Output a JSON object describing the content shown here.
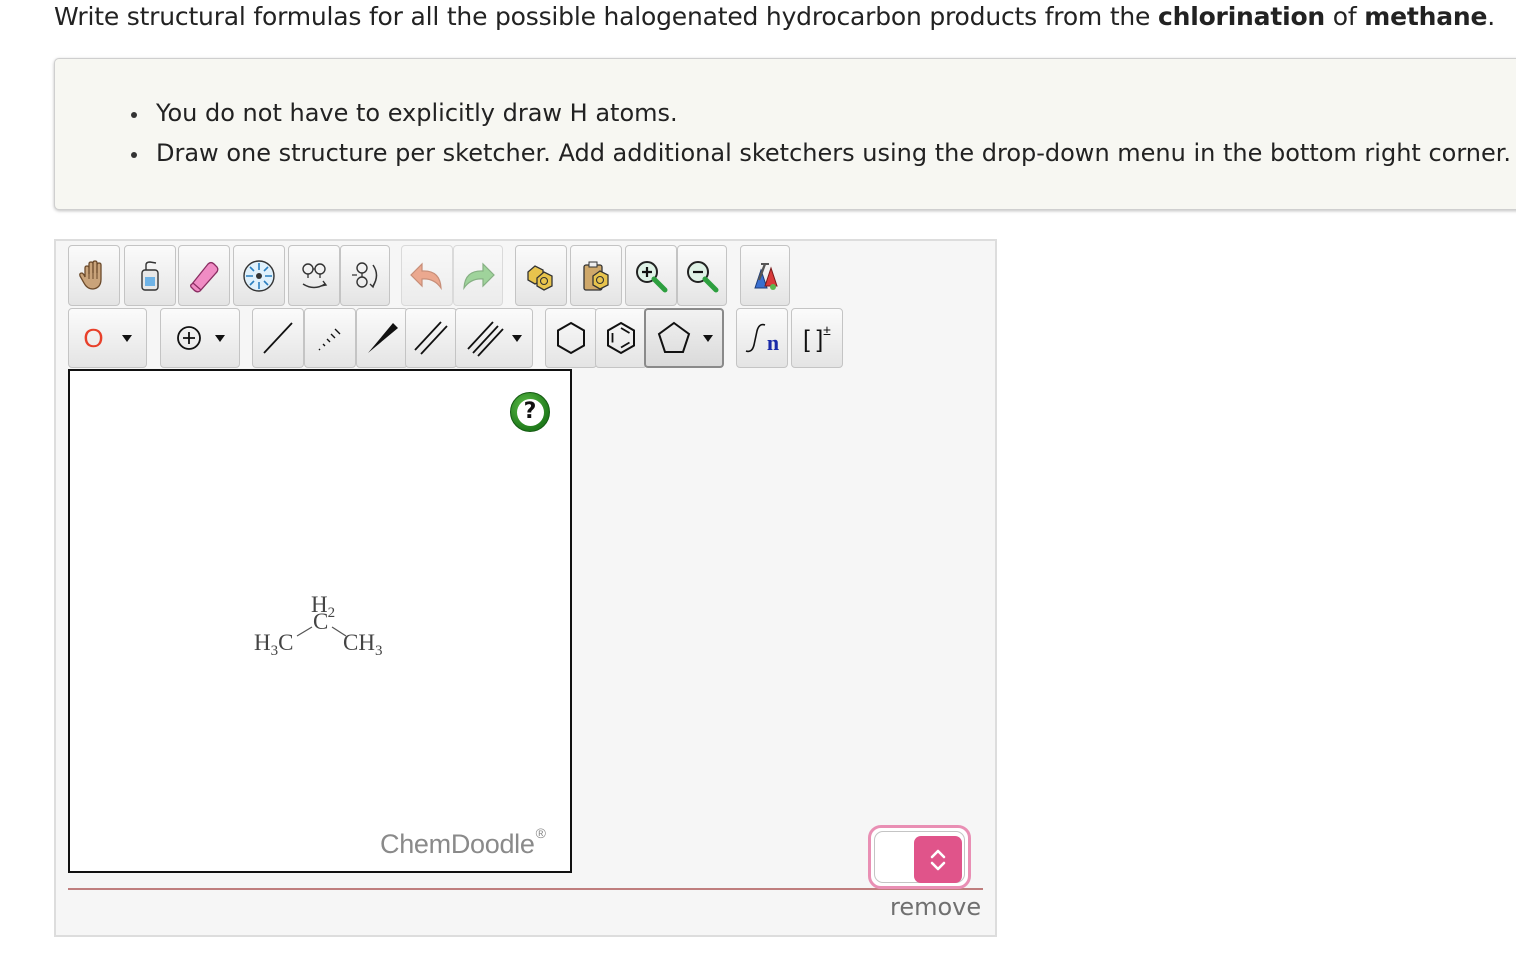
{
  "question": {
    "prefix": "Write structural formulas for all the possible halogenated hydrocarbon products from the ",
    "bold1": "chlorination",
    "middle": " of ",
    "bold2": "methane",
    "suffix": "."
  },
  "instructions": [
    "You do not have to explicitly draw H atoms.",
    "Draw one structure per sketcher. Add additional sketchers using the drop-down menu in the bottom right corner."
  ],
  "toolbar": {
    "row1_icons": [
      "hand-icon",
      "lasso-icon",
      "eraser-icon",
      "center-icon",
      "flip-horizontal-icon",
      "flip-vertical-icon",
      "undo-icon",
      "redo-icon",
      "copy-icon",
      "paste-icon",
      "zoom-in-icon",
      "zoom-out-icon",
      "clean-icon"
    ],
    "row2_icons": [
      "element-dropdown",
      "charge-dropdown",
      "single-bond-icon",
      "dashed-bond-icon",
      "wedge-bond-icon",
      "double-bond-icon",
      "triple-bond-dropdown",
      "cyclohexane-icon",
      "benzene-icon",
      "cyclopentane-dropdown",
      "repeat-unit-icon",
      "bracket-charge-icon"
    ],
    "element_label": "O",
    "element_color": "#e8402a",
    "repeat_label": "n",
    "repeat_color": "#1a2aa8",
    "bracket_label": "[ ]",
    "bracket_sup": "±"
  },
  "canvas": {
    "molecule_atoms": [
      {
        "label": "H",
        "sub": "3",
        "after": "C"
      },
      {
        "label": "H",
        "sub": "2",
        "after": ""
      },
      {
        "label": "C",
        "sub": "",
        "after": ""
      },
      {
        "label": "CH",
        "sub": "3",
        "after": ""
      }
    ],
    "help_label": "?",
    "watermark": "ChemDoodle",
    "watermark_mark": "®"
  },
  "controls": {
    "remove_label": "remove",
    "select_accent": "#e0548a",
    "select_border": "#e98fb4"
  },
  "colors": {
    "panel_bg": "#f6f6f6",
    "instructions_bg": "#f7f7f2",
    "divider": "#bf7e7e"
  }
}
